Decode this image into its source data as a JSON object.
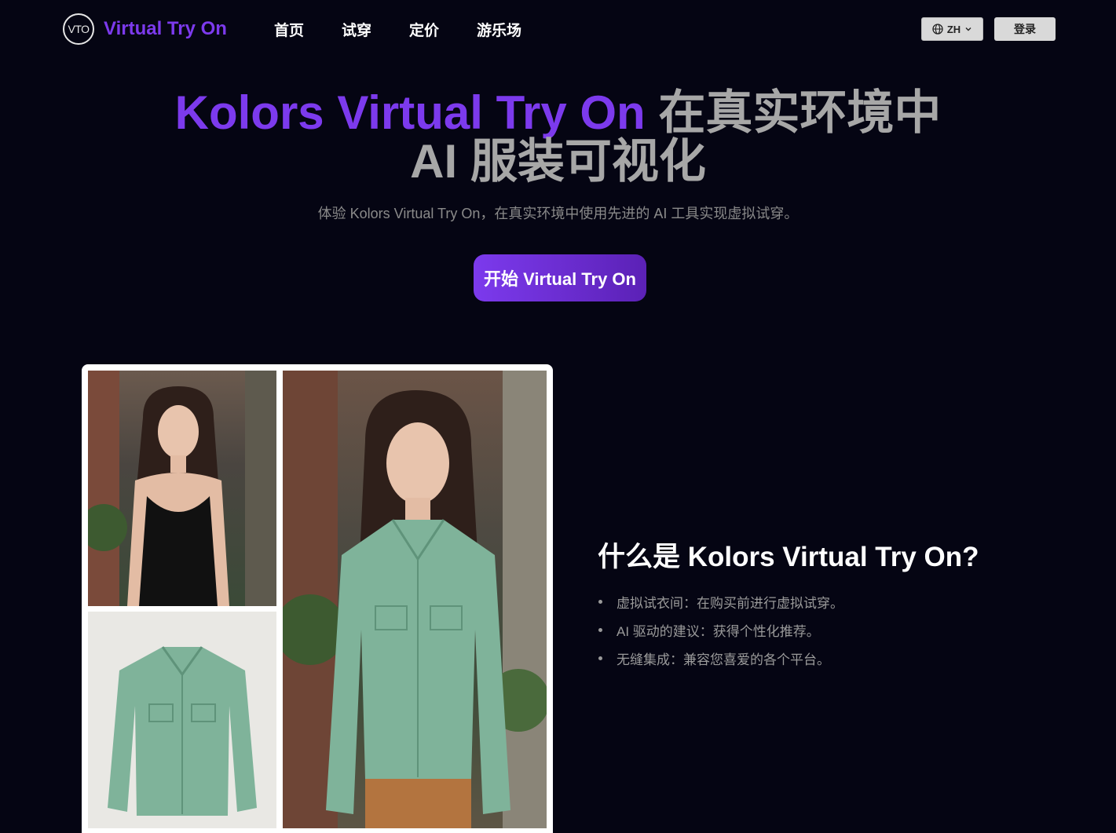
{
  "header": {
    "logo_mark": "VTO",
    "logo_text": "Virtual Try On",
    "nav": [
      "首页",
      "试穿",
      "定价",
      "游乐场"
    ],
    "lang_label": "ZH",
    "login_label": "登录"
  },
  "hero": {
    "title_accent": "Kolors Virtual Try On",
    "title_rest_1": " 在真实环境中",
    "title_line_2": "AI 服装可视化",
    "subtitle": "体验 Kolors Virtual Try On，在真实环境中使用先进的 AI 工具实现虚拟试穿。",
    "cta_label": "开始 Virtual Try On"
  },
  "what_is": {
    "title": "什么是 Kolors Virtual Try On?",
    "features": [
      "虚拟试衣间：在购买前进行虚拟试穿。",
      "AI 驱动的建议：获得个性化推荐。",
      "无缝集成：兼容您喜爱的各个平台。"
    ]
  },
  "colors": {
    "accent": "#7c3aed",
    "background": "#050513",
    "jacket": "#7fb39a"
  }
}
